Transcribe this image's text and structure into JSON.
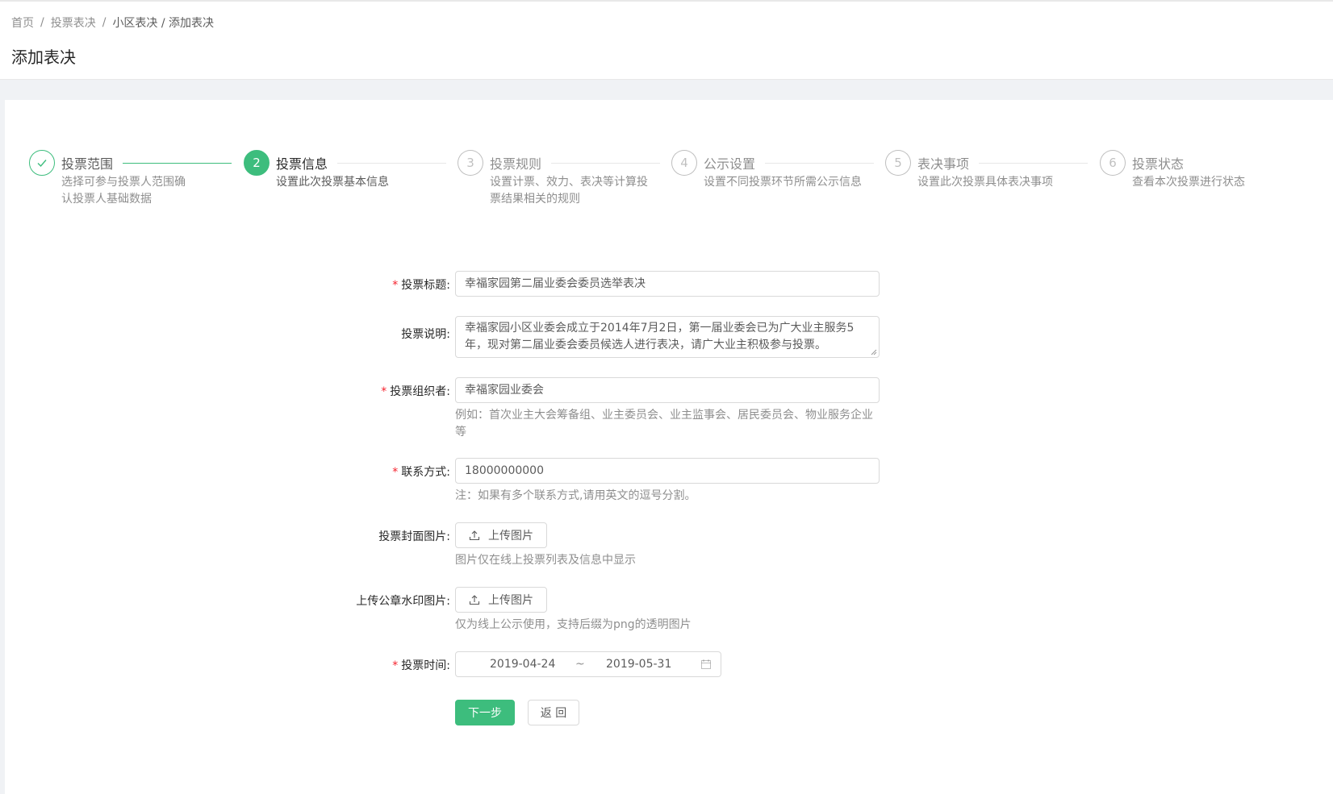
{
  "breadcrumb": {
    "items": [
      "首页",
      "投票表决",
      "小区表决 / 添加表决"
    ],
    "separator": "/"
  },
  "page_title": "添加表决",
  "steps": [
    {
      "number": "✓",
      "title": "投票范围",
      "desc": "选择可参与投票人范围确认投票人基础数据",
      "status": "done"
    },
    {
      "number": "2",
      "title": "投票信息",
      "desc": "设置此次投票基本信息",
      "status": "active"
    },
    {
      "number": "3",
      "title": "投票规则",
      "desc": "设置计票、效力、表决等计算投票结果相关的规则",
      "status": "wait"
    },
    {
      "number": "4",
      "title": "公示设置",
      "desc": "设置不同投票环节所需公示信息",
      "status": "wait"
    },
    {
      "number": "5",
      "title": "表决事项",
      "desc": "设置此次投票具体表决事项",
      "status": "wait"
    },
    {
      "number": "6",
      "title": "投票状态",
      "desc": "查看本次投票进行状态",
      "status": "wait"
    }
  ],
  "form": {
    "title": {
      "label": "投票标题",
      "required": true,
      "value": "幸福家园第二届业委会委员选举表决"
    },
    "description": {
      "label": "投票说明",
      "required": false,
      "value": "幸福家园小区业委会成立于2014年7月2日，第一届业委会已为广大业主服务5年，现对第二届业委会委员候选人进行表决，请广大业主积极参与投票。"
    },
    "organizer": {
      "label": "投票组织者",
      "required": true,
      "value": "幸福家园业委会",
      "hint": "例如：首次业主大会筹备组、业主委员会、业主监事会、居民委员会、物业服务企业等"
    },
    "contact": {
      "label": "联系方式",
      "required": true,
      "value": "18000000000",
      "hint": "注：如果有多个联系方式,请用英文的逗号分割。"
    },
    "cover": {
      "label": "投票封面图片",
      "required": false,
      "button": "上传图片",
      "hint": "图片仅在线上投票列表及信息中显示"
    },
    "seal": {
      "label": "上传公章水印图片",
      "required": false,
      "button": "上传图片",
      "hint": "仅为线上公示使用，支持后缀为png的透明图片"
    },
    "time": {
      "label": "投票时间",
      "required": true,
      "start": "2019-04-24",
      "end": "2019-05-31",
      "separator": "~"
    }
  },
  "actions": {
    "next": "下一步",
    "back": "返 回"
  },
  "colors": {
    "primary": "#3dbd7d",
    "required": "#f5222d"
  }
}
